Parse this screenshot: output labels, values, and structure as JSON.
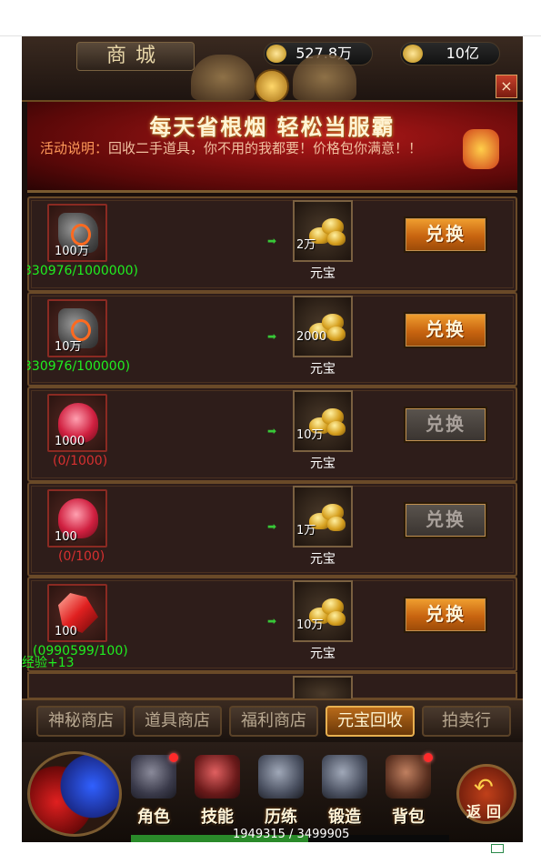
{
  "header": {
    "title": "商城",
    "resources": [
      {
        "icon": "coin-icon",
        "value": "527.8万"
      },
      {
        "icon": "gold-ingot-icon",
        "value": "10亿"
      }
    ],
    "close_label": "×"
  },
  "banner": {
    "title": "每天省根烟 轻松当服霸",
    "desc_label": "活动说明：",
    "desc_text": "回收二手道具，你不用的我都要！价格包你满意！！"
  },
  "rows": [
    {
      "item_icon": "gray-stone-icon",
      "item_qty": "100万",
      "progress": "330976/1000000)",
      "progress_state": "green",
      "reward_qty": "2万",
      "reward_name": "元宝",
      "button": "兑换",
      "button_state": "active"
    },
    {
      "item_icon": "gray-stone-icon",
      "item_qty": "10万",
      "progress": "330976/100000)",
      "progress_state": "green",
      "reward_qty": "2000",
      "reward_name": "元宝",
      "button": "兑换",
      "button_state": "active"
    },
    {
      "item_icon": "red-gem-icon",
      "item_qty": "1000",
      "progress": "(0/1000)",
      "progress_state": "red",
      "reward_qty": "10万",
      "reward_name": "元宝",
      "button": "兑换",
      "button_state": "disabled"
    },
    {
      "item_icon": "red-gem-icon",
      "item_qty": "100",
      "progress": "(0/100)",
      "progress_state": "red",
      "reward_qty": "1万",
      "reward_name": "元宝",
      "button": "兑换",
      "button_state": "disabled"
    },
    {
      "item_icon": "red-crystal-icon",
      "item_qty": "100",
      "progress": "(0990599/100)",
      "progress_state": "green",
      "reward_qty": "10万",
      "reward_name": "元宝",
      "button": "兑换",
      "button_state": "active"
    }
  ],
  "xp_float": "经验+13",
  "tabs": [
    {
      "label": "神秘商店",
      "active": false
    },
    {
      "label": "道具商店",
      "active": false
    },
    {
      "label": "福利商店",
      "active": false
    },
    {
      "label": "元宝回收",
      "active": true
    },
    {
      "label": "拍卖行",
      "active": false
    }
  ],
  "nav": [
    {
      "label": "角色",
      "icon": "character-icon",
      "badge": true
    },
    {
      "label": "技能",
      "icon": "skill-book-icon",
      "badge": false
    },
    {
      "label": "历练",
      "icon": "armor-icon",
      "badge": false
    },
    {
      "label": "锻造",
      "icon": "forge-icon",
      "badge": false
    },
    {
      "label": "背包",
      "icon": "backpack-icon",
      "badge": true
    }
  ],
  "back_label": "返回",
  "exp_text": "1949315 / 3499905",
  "exp_progress": 0.557
}
